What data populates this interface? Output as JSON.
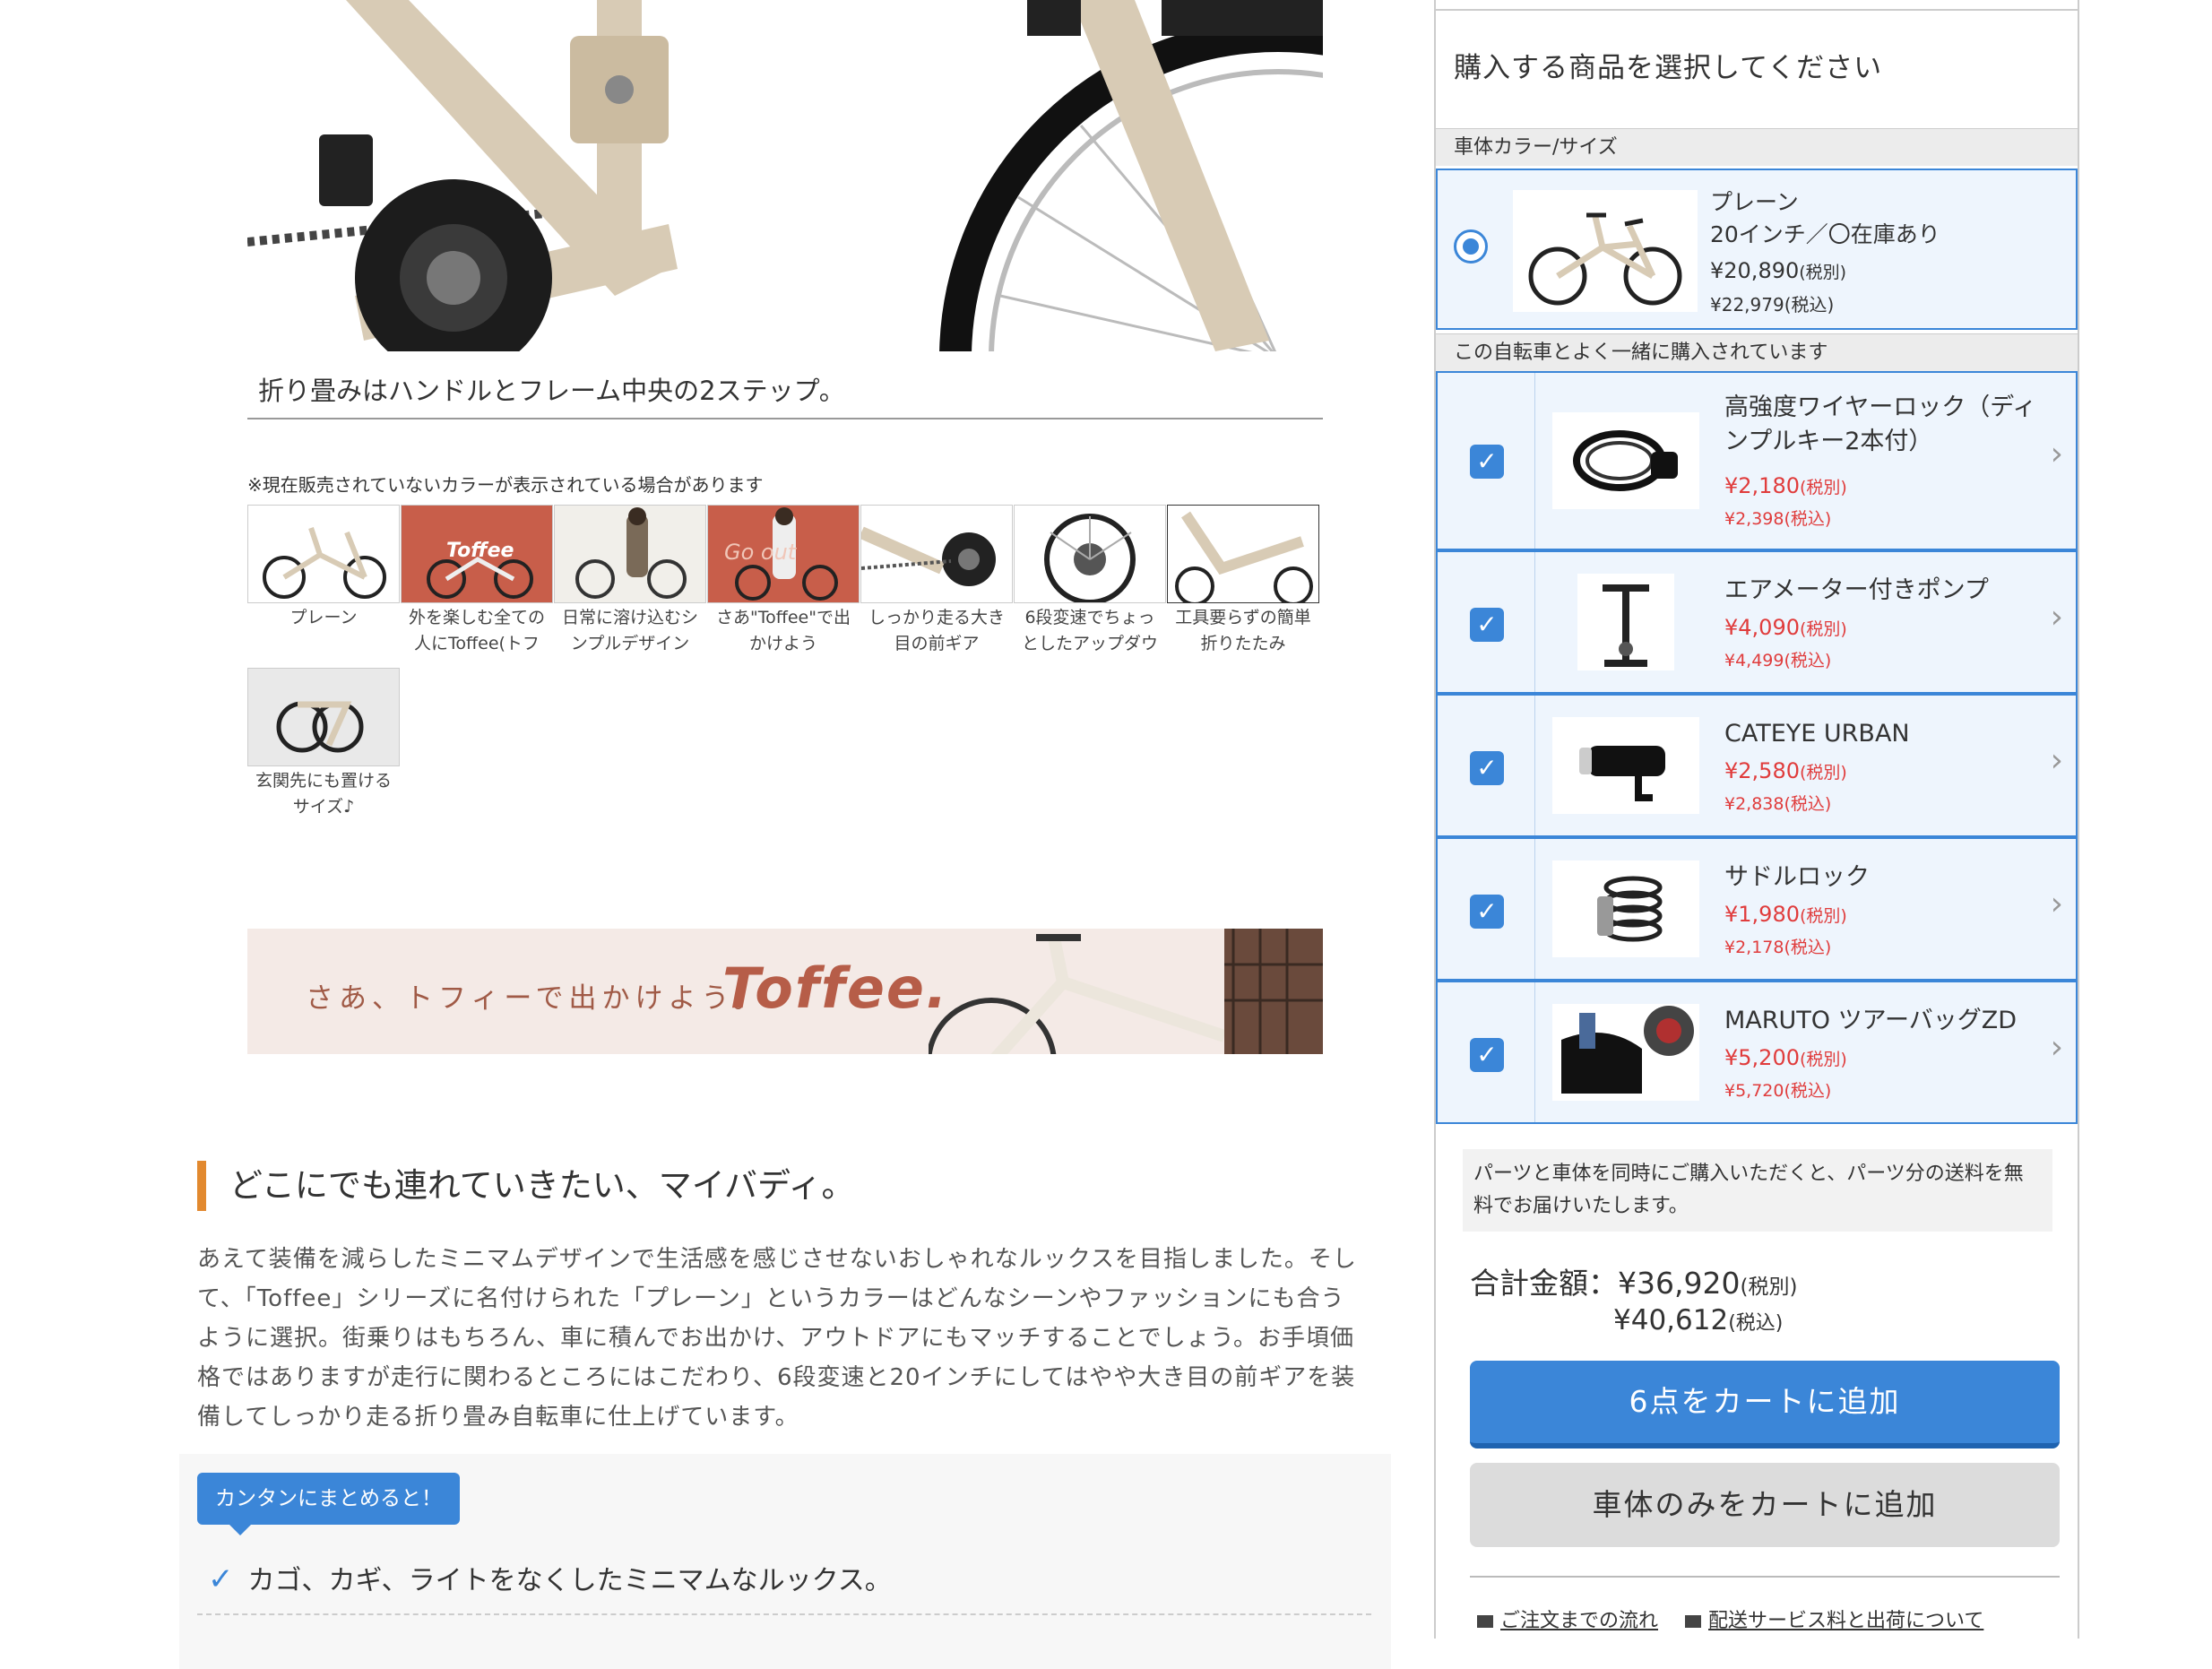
{
  "hero": {
    "caption": "折り畳みはハンドルとフレーム中央の2ステップ。"
  },
  "gallery": {
    "note": "※現在販売されていないカラーが表示されている場合があります",
    "items": [
      {
        "line1": "プレーン",
        "line2": ""
      },
      {
        "line1": "外を楽しむ全ての",
        "line2": "人にToffee(トフ"
      },
      {
        "line1": "日常に溶け込むシ",
        "line2": "ンプルデザイン"
      },
      {
        "line1": "さあ\"Toffee\"で出",
        "line2": "かけよう"
      },
      {
        "line1": "しっかり走る大き",
        "line2": "目の前ギア"
      },
      {
        "line1": "6段変速でちょっ",
        "line2": "としたアップダウ"
      },
      {
        "line1": "工具要らずの簡単",
        "line2": "折りたたみ"
      },
      {
        "line1": "玄関先にも置ける",
        "line2": "サイズ♪"
      }
    ],
    "thumb_text": {
      "t2": "Toffee",
      "t4": "Go out"
    }
  },
  "banner": {
    "text": "さあ、トフィーで出かけよう。",
    "logo": "Toffee."
  },
  "section": {
    "heading": "どこにでも連れていきたい、マイバディ。",
    "lines": [
      "あえて装備を減らしたミニマムデザインで生活感を感じさせないおしゃれなルックスを目指しました。そし",
      "て、「Toffee」シリーズに名付けられた「プレーン」というカラーはどんなシーンやファッションにも合う",
      "ように選択。街乗りはもちろん、車に積んでお出かけ、アウトドアにもマッチすることでしょう。お手頃価",
      "格ではありますが走行に関わるところにはこだわり、6段変速と20インチにしてはやや大き目の前ギアを装",
      "備してしっかり走る折り畳み自転車に仕上げています。"
    ]
  },
  "summary": {
    "badge": "カンタンにまとめると！",
    "item1": "カゴ、カギ、ライトをなくしたミニマムなルックス。"
  },
  "panel": {
    "title": "購入する商品を選択してください",
    "body_section": "車体カラー/サイズ",
    "body": {
      "name": "プレーン",
      "size": "20インチ／〇在庫あり",
      "price_ex": "¥20,890",
      "price_ex_note": "(税別)",
      "price_in": "¥22,979",
      "price_in_note": "(税込)"
    },
    "acc_section": "この自転車とよく一緒に購入されています",
    "accessories": [
      {
        "name": "高強度ワイヤーロック（ディンプルキー2本付）",
        "price_ex": "¥2,180",
        "price_in": "¥2,398",
        "icon": "wire-lock-icon"
      },
      {
        "name": "エアメーター付きポンプ",
        "price_ex": "¥4,090",
        "price_in": "¥4,499",
        "icon": "pump-icon"
      },
      {
        "name": "CATEYE URBAN",
        "price_ex": "¥2,580",
        "price_in": "¥2,838",
        "icon": "bike-light-icon"
      },
      {
        "name": "サドルロック",
        "price_ex": "¥1,980",
        "price_in": "¥2,178",
        "icon": "saddle-lock-icon"
      },
      {
        "name": "MARUTO ツアーバッグZD",
        "price_ex": "¥5,200",
        "price_in": "¥5,720",
        "icon": "tour-bag-icon"
      }
    ],
    "tax_ex": "(税別)",
    "tax_in": "(税込)",
    "check_glyph": "✓",
    "chevron_glyph": "›",
    "ship_note": "パーツと車体を同時にご購入いただくと、パーツ分の送料を無料でお届けいたします。",
    "total_label": "合計金額：",
    "total_ex": "¥36,920",
    "total_in": "¥40,612",
    "cart_button": "6点をカートに追加",
    "body_only_button": "車体のみをカートに追加",
    "link1": "ご注文までの流れ",
    "link2": "配送サービス料と出荷について"
  },
  "colors": {
    "accent": "#3b86d8",
    "price_red": "#e03c3c",
    "heading_bar": "#e2892f",
    "frame_beige": "#d8cbb5"
  }
}
